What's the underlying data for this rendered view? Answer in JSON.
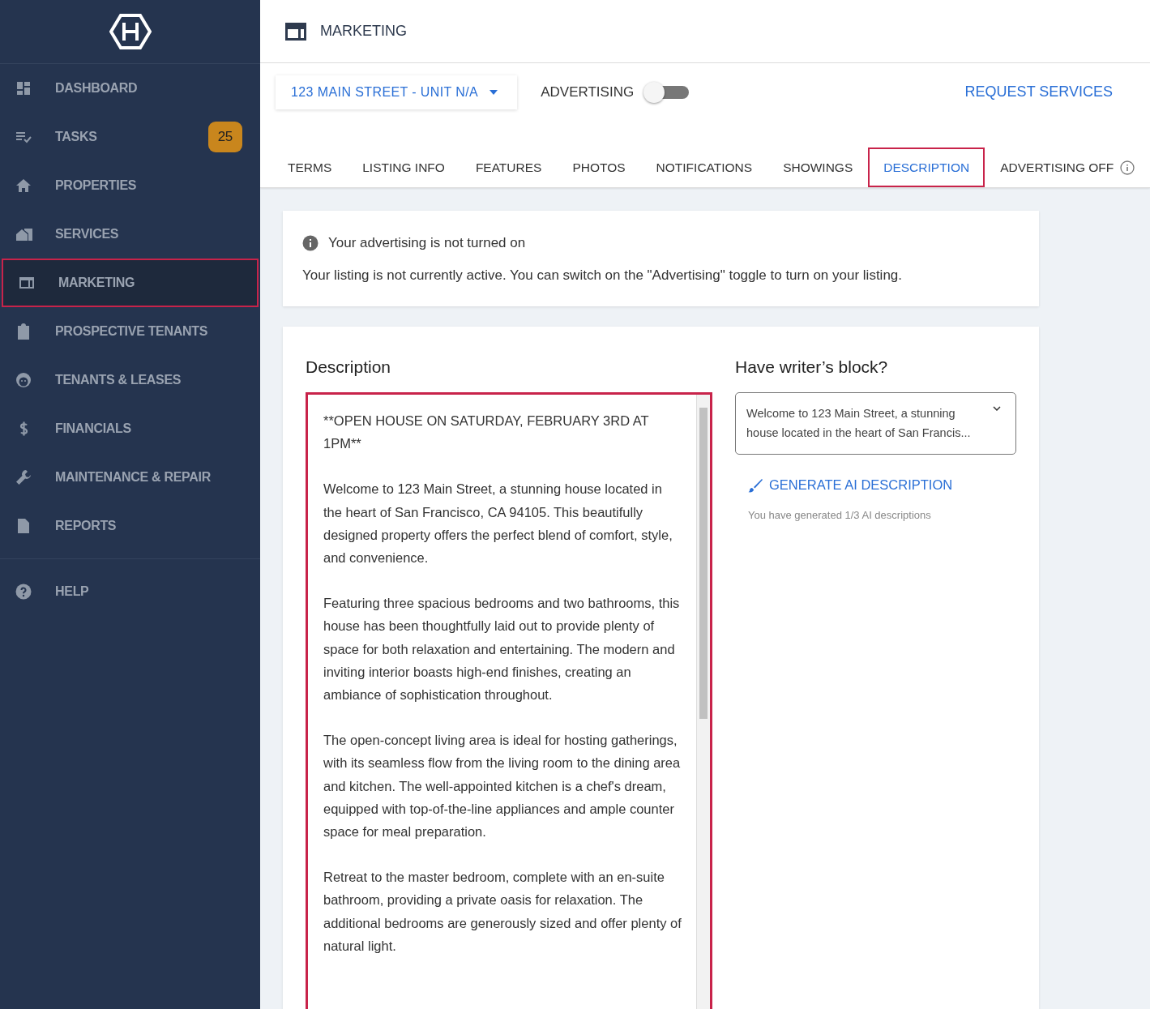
{
  "sidebar": {
    "items": [
      {
        "label": "DASHBOARD",
        "selected": false
      },
      {
        "label": "TASKS",
        "selected": false,
        "badge": "25"
      },
      {
        "label": "PROPERTIES",
        "selected": false
      },
      {
        "label": "SERVICES",
        "selected": false
      },
      {
        "label": "MARKETING",
        "selected": true
      },
      {
        "label": "PROSPECTIVE TENANTS",
        "selected": false
      },
      {
        "label": "TENANTS & LEASES",
        "selected": false
      },
      {
        "label": "FINANCIALS",
        "selected": false
      },
      {
        "label": "MAINTENANCE & REPAIR",
        "selected": false
      },
      {
        "label": "REPORTS",
        "selected": false
      }
    ],
    "footer_items": [
      {
        "label": "HELP",
        "selected": false
      }
    ]
  },
  "header": {
    "title": "MARKETING"
  },
  "toolbar": {
    "property_select": "123 MAIN STREET - UNIT N/A",
    "advertising_label": "ADVERTISING",
    "advertising_on": false,
    "request_services": "REQUEST SERVICES"
  },
  "tabs": [
    {
      "label": "TERMS",
      "selected": false
    },
    {
      "label": "LISTING INFO",
      "selected": false
    },
    {
      "label": "FEATURES",
      "selected": false
    },
    {
      "label": "PHOTOS",
      "selected": false
    },
    {
      "label": "NOTIFICATIONS",
      "selected": false
    },
    {
      "label": "SHOWINGS",
      "selected": false
    },
    {
      "label": "DESCRIPTION",
      "selected": true
    },
    {
      "label": "ADVERTISING OFF",
      "selected": false,
      "info": true
    }
  ],
  "notice": {
    "title": "Your advertising is not turned on",
    "message": "Your listing is not currently active. You can switch on the \"Advertising\" toggle to turn on your listing."
  },
  "description": {
    "heading": "Description",
    "paragraphs": [
      "**OPEN HOUSE ON SATURDAY, FEBRUARY 3RD AT 1PM**",
      "Welcome to 123 Main Street, a stunning house located in the heart of San Francisco, CA 94105. This beautifully designed property offers the perfect blend of comfort, style, and convenience.",
      "Featuring three spacious bedrooms and two bathrooms, this house has been thoughtfully laid out to provide plenty of space for both relaxation and entertaining. The modern and inviting interior boasts high-end finishes, creating an ambiance of sophistication throughout.",
      "The open-concept living area is ideal for hosting gatherings, with its seamless flow from the living room to the dining area and kitchen. The well-appointed kitchen is a chef's dream, equipped with top-of-the-line appliances and ample counter space for meal preparation.",
      "Retreat to the master bedroom, complete with an en-suite bathroom, providing a private oasis for relaxation. The additional bedrooms are generously sized and offer plenty of natural light."
    ]
  },
  "writers_block": {
    "heading": "Have writer’s block?",
    "suggestion": "Welcome to 123 Main Street, a stunning house located in the heart of San Francis...",
    "generate_button": "GENERATE AI DESCRIPTION",
    "usage": "You have generated 1/3 AI descriptions"
  }
}
